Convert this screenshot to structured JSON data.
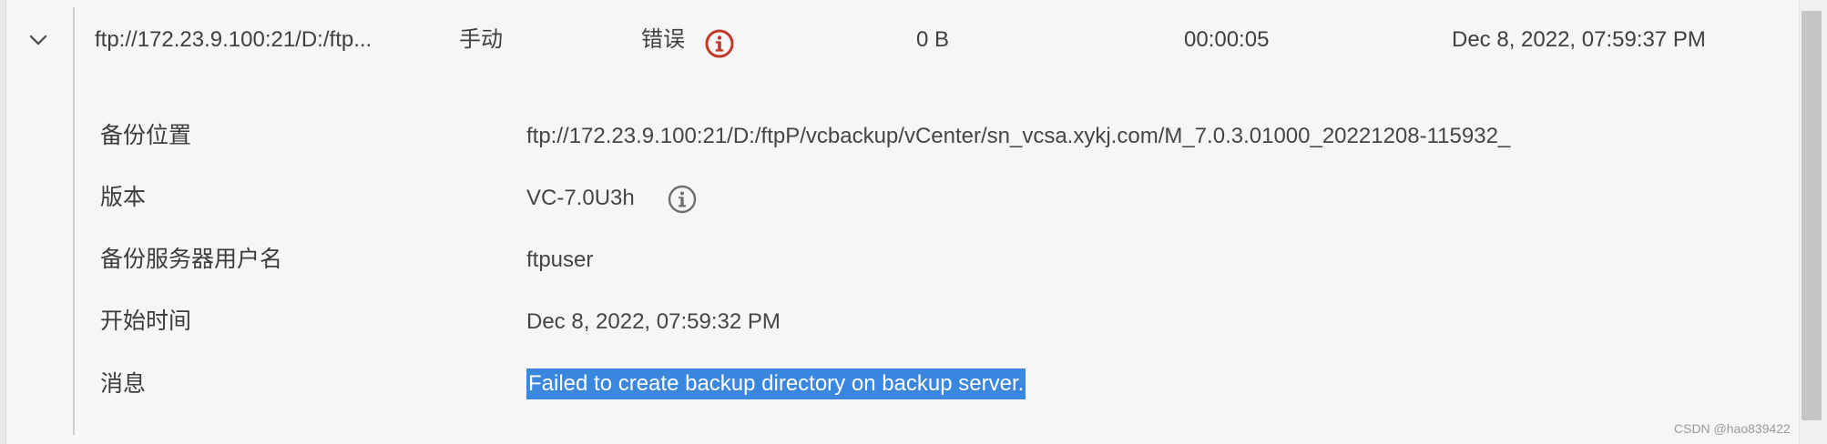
{
  "row": {
    "location": "ftp://172.23.9.100:21/D:/ftp...",
    "type": "手动",
    "status": "错误",
    "size": "0 B",
    "duration": "00:00:05",
    "end_time": "Dec 8, 2022, 07:59:37 PM"
  },
  "details": {
    "backup_location_label": "备份位置",
    "backup_location_value": "ftp://172.23.9.100:21/D:/ftpP/vcbackup/vCenter/sn_vcsa.xykj.com/M_7.0.3.01000_20221208-115932_",
    "version_label": "版本",
    "version_value": "VC-7.0U3h",
    "username_label": "备份服务器用户名",
    "username_value": "ftpuser",
    "start_time_label": "开始时间",
    "start_time_value": "Dec 8, 2022, 07:59:32 PM",
    "message_label": "消息",
    "message_value": "Failed to create backup directory on backup server."
  },
  "icons": {
    "toggle": "chevron-down-icon",
    "status": "error-info-icon",
    "version_info": "info-circle-icon"
  },
  "colors": {
    "error": "#c0392b",
    "selection": "#3b87e0"
  },
  "watermark": "CSDN @hao839422"
}
